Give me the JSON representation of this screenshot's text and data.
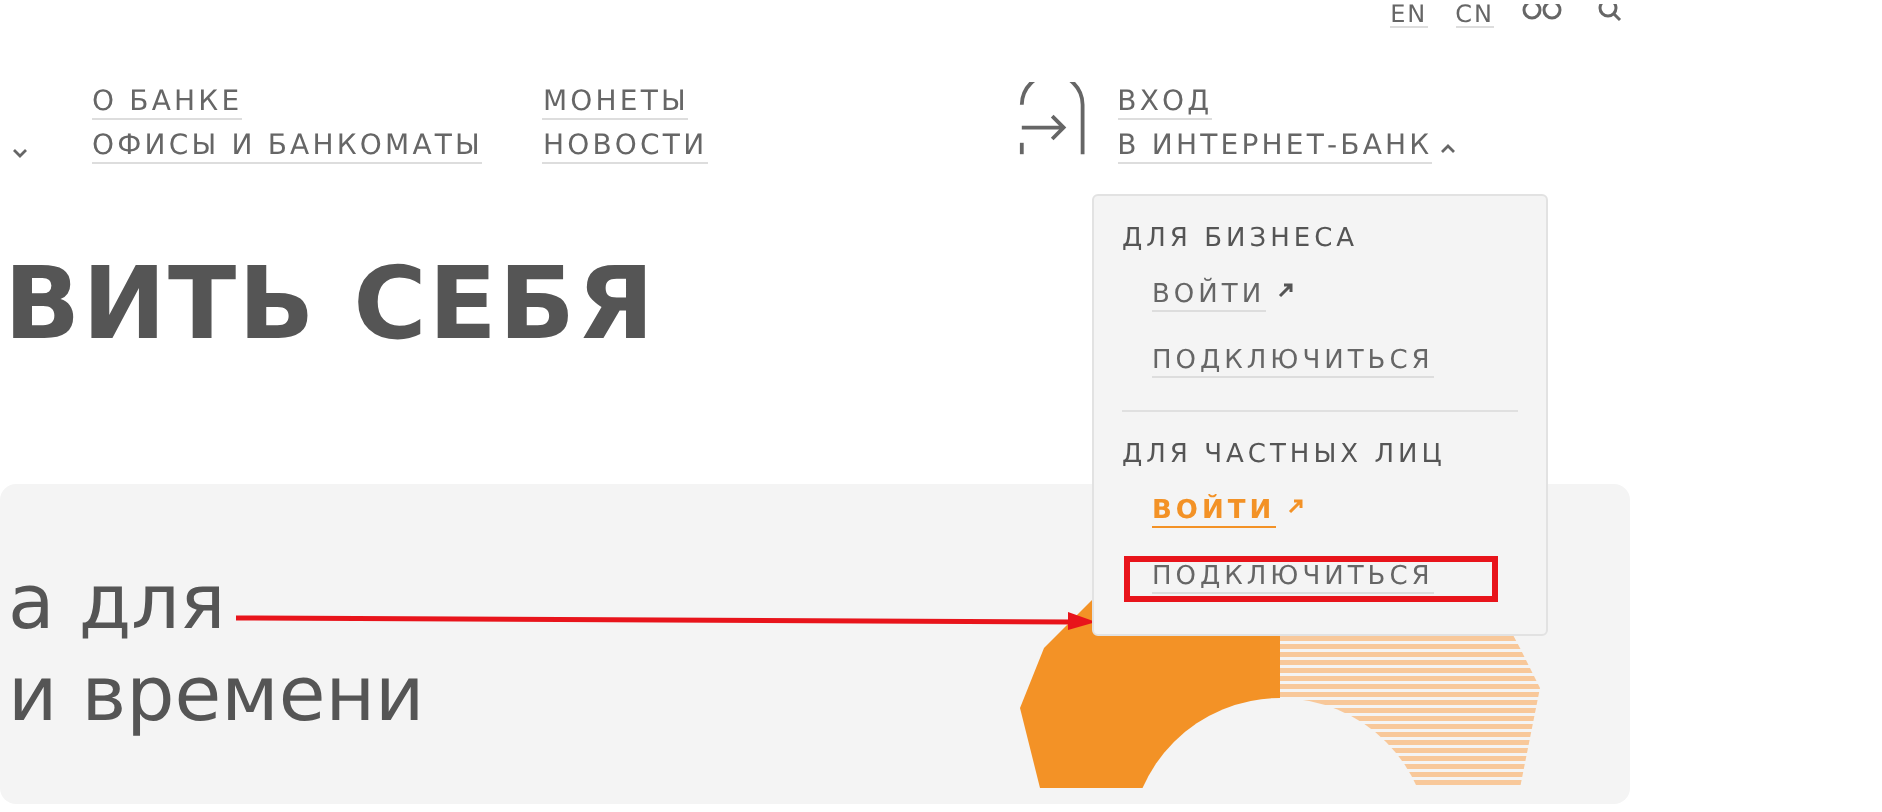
{
  "top_links": [
    "EN",
    "CN"
  ],
  "nav_columns": [
    {
      "items": [
        "О БАНКЕ",
        "ОФИСЫ И БАНКОМАТЫ"
      ]
    },
    {
      "items": [
        "МОНЕТЫ",
        "НОВОСТИ"
      ]
    }
  ],
  "login": {
    "line1": "ВХОД",
    "line2": "В ИНТЕРНЕТ-БАНК",
    "expanded": true
  },
  "dropdown": {
    "sections": [
      {
        "title": "ДЛЯ БИЗНЕСА",
        "items": [
          {
            "label": "ВОЙТИ",
            "external": true,
            "active": false,
            "highlighted": false
          },
          {
            "label": "ПОДКЛЮЧИТЬСЯ",
            "external": false,
            "active": false,
            "highlighted": false
          }
        ]
      },
      {
        "title": "ДЛЯ ЧАСТНЫХ ЛИЦ",
        "items": [
          {
            "label": "ВОЙТИ",
            "external": true,
            "active": true,
            "highlighted": false
          },
          {
            "label": "ПОДКЛЮЧИТЬСЯ",
            "external": false,
            "active": false,
            "highlighted": true
          }
        ]
      }
    ]
  },
  "heading": "ВИТЬ СЕБЯ",
  "card": {
    "lines": [
      "а для",
      "и времени"
    ]
  }
}
